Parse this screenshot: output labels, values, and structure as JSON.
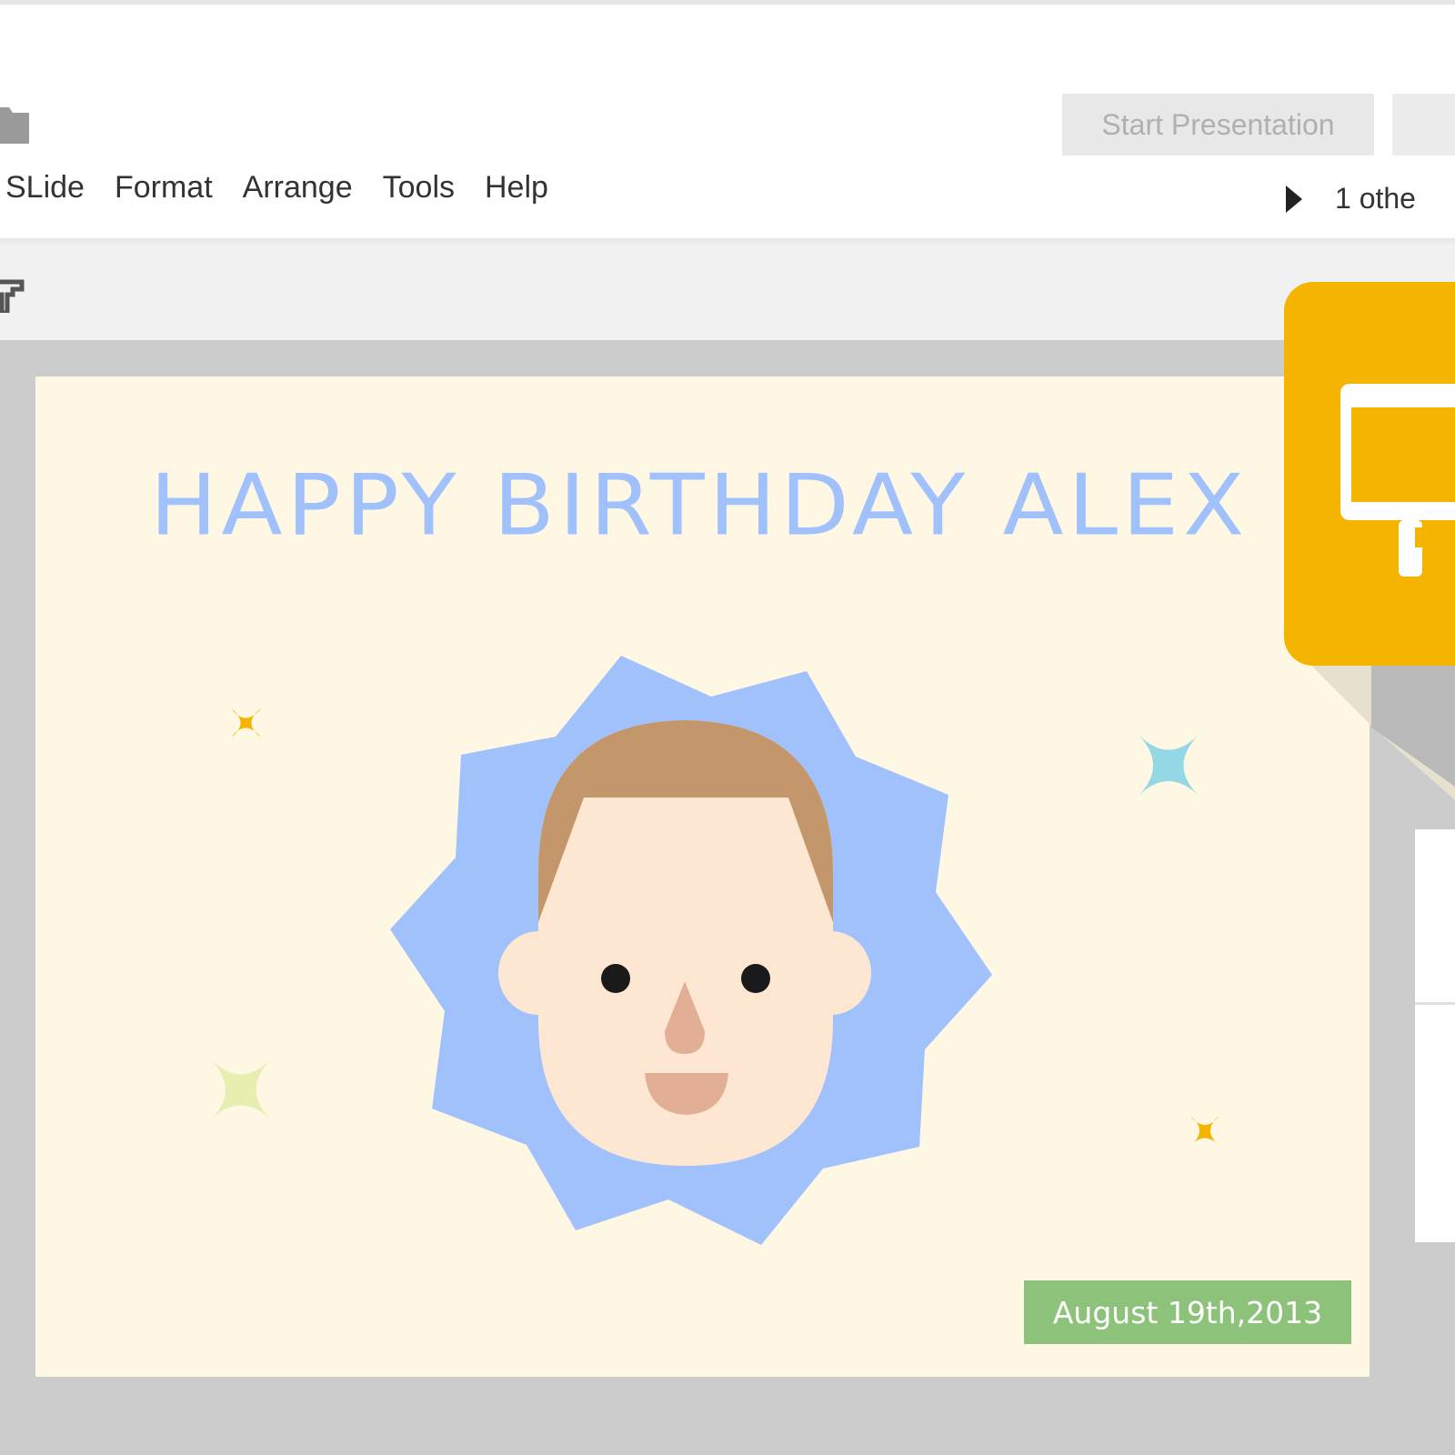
{
  "app": {
    "menu": [
      {
        "id": "slide",
        "label": "SLide"
      },
      {
        "id": "format",
        "label": "Format"
      },
      {
        "id": "arrange",
        "label": "Arrange"
      },
      {
        "id": "tools",
        "label": "Tools"
      },
      {
        "id": "help",
        "label": "Help"
      }
    ],
    "start_presentation_label": "Start Presentation",
    "others_label": "1 othe",
    "brand_color": "#f4b400"
  },
  "slide": {
    "title": "HAPPY BIRTHDAY ALEX",
    "date": "August 19th,2013",
    "background_color": "#fef7e3",
    "title_color": "#a1c1fc",
    "badge_color": "#8dc27a",
    "illustration": [
      "sunburst",
      "boy-face",
      "sparkle-orange",
      "sparkle-blue",
      "sparkle-green"
    ]
  },
  "icons": [
    "folder-icon",
    "paint-format-icon",
    "play-icon",
    "slides-logo-icon"
  ]
}
